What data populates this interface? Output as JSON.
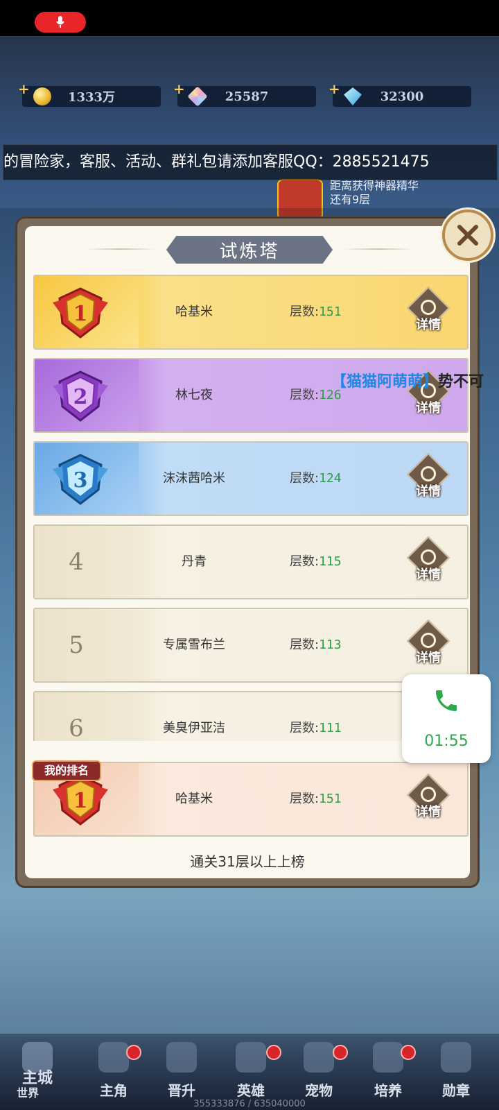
{
  "resources": [
    {
      "icon": "gold-coin-icon",
      "value": "1333万",
      "color": "#e8c34a"
    },
    {
      "icon": "rainbow-crystal-icon",
      "value": "25587",
      "color": "#b48ee6"
    },
    {
      "icon": "blue-diamond-icon",
      "value": "32300",
      "color": "#6cc7e8"
    }
  ],
  "marquee_text": "的冒险家，客服、活动、群礼包请添加客服QQ：2885521475",
  "floor_info": {
    "line1": "距离获得神器精华",
    "line2": "还有9层"
  },
  "panel": {
    "title": "试炼塔",
    "rows": [
      {
        "rank": "1",
        "name": "哈基米",
        "floor_label": "层数:",
        "floor": "151",
        "detail": "详情",
        "tier": "gold"
      },
      {
        "rank": "2",
        "name": "林七夜",
        "floor_label": "层数:",
        "floor": "126",
        "detail": "详情",
        "tier": "purple"
      },
      {
        "rank": "3",
        "name": "沫沫茜哈米",
        "floor_label": "层数:",
        "floor": "124",
        "detail": "详情",
        "tier": "blue"
      },
      {
        "rank": "4",
        "name": "丹青",
        "floor_label": "层数:",
        "floor": "115",
        "detail": "详情",
        "tier": "plain"
      },
      {
        "rank": "5",
        "name": "专属雪布兰",
        "floor_label": "层数:",
        "floor": "113",
        "detail": "详情",
        "tier": "plain"
      },
      {
        "rank": "6",
        "name": "美臭伊亚洁",
        "floor_label": "层数:",
        "floor": "111",
        "detail": "详情",
        "tier": "plain"
      }
    ],
    "my_rank": {
      "label": "我的排名",
      "rank": "1",
      "name": "哈基米",
      "floor_label": "层数:",
      "floor": "151",
      "detail": "详情"
    },
    "footer": "通关31层以上上榜"
  },
  "danmaku": {
    "user": "【猫猫阿萌萌】",
    "text": "势不可"
  },
  "call": {
    "time": "01:55",
    "icon": "phone-icon"
  },
  "nav": [
    {
      "label": "主城",
      "sub": "世界",
      "icon": "castle-icon",
      "dot": false
    },
    {
      "label": "主角",
      "icon": "hero-head-icon",
      "dot": true
    },
    {
      "label": "晋升",
      "icon": "promote-icon",
      "dot": false
    },
    {
      "label": "英雄",
      "icon": "helmet-icon",
      "dot": true
    },
    {
      "label": "宠物",
      "icon": "pet-icon",
      "dot": true
    },
    {
      "label": "培养",
      "icon": "train-icon",
      "dot": true
    },
    {
      "label": "勋章",
      "icon": "medal-nav-icon",
      "dot": false
    }
  ],
  "exp_text": "355333876 / 635040000"
}
